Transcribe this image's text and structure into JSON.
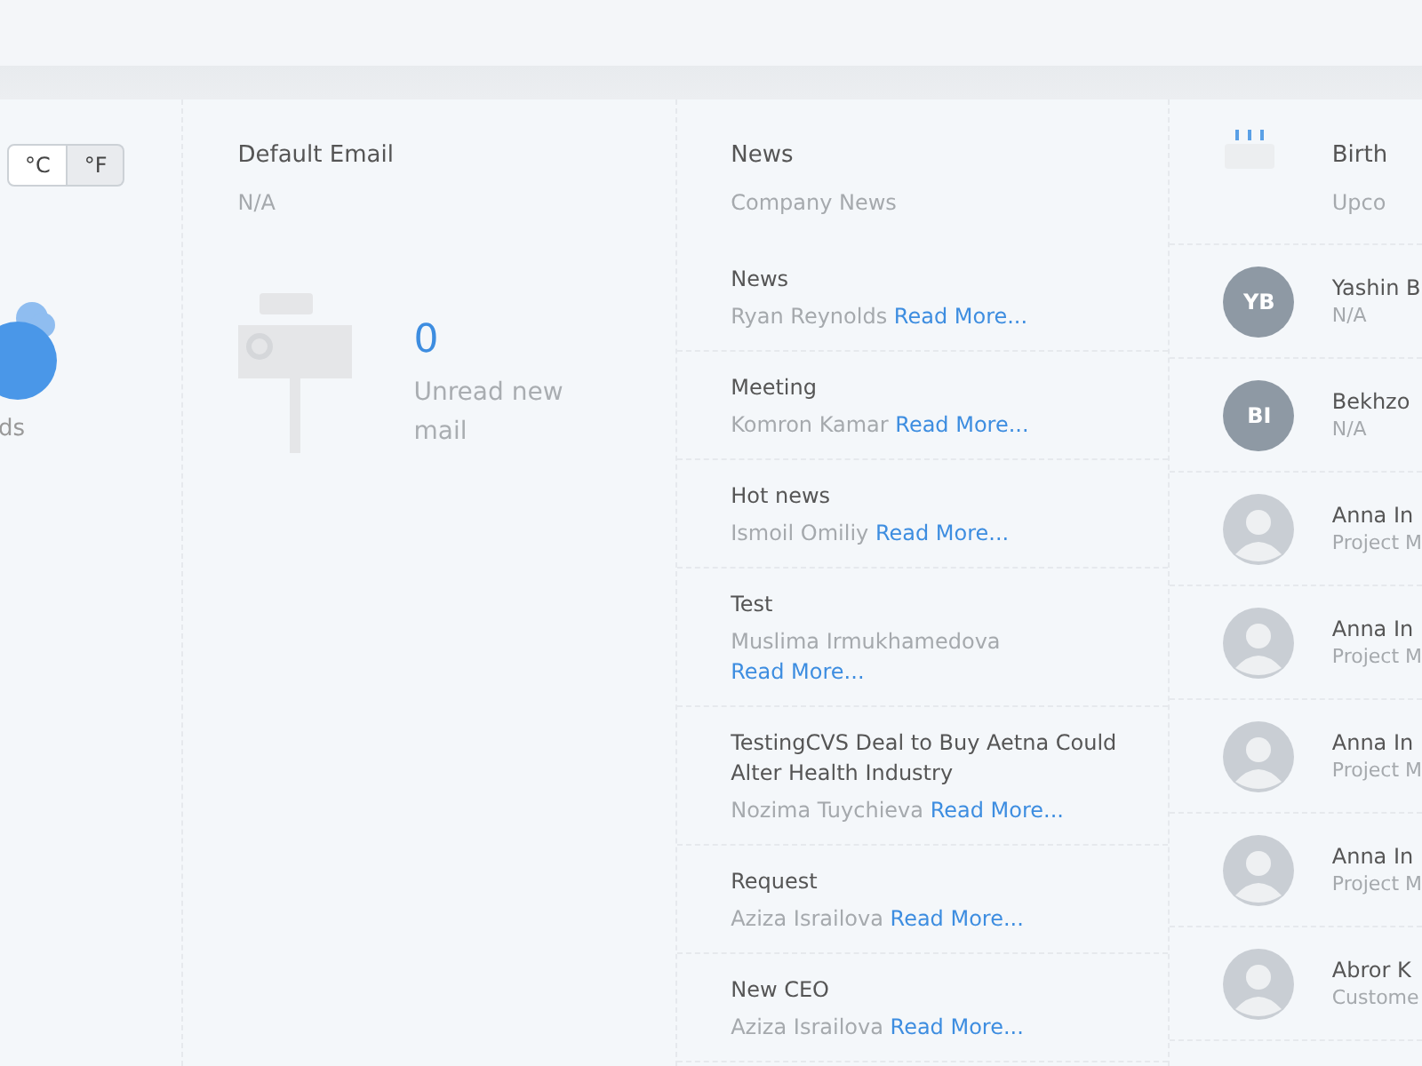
{
  "weather": {
    "units": [
      {
        "label": "°C",
        "selected": false
      },
      {
        "label": "°F",
        "selected": true
      }
    ],
    "caption": "ds"
  },
  "email": {
    "title": "Default Email",
    "value": "N/A",
    "count": "0",
    "label": "Unread new mail"
  },
  "news": {
    "title": "News",
    "subtitle": "Company News",
    "items": [
      {
        "title": "News",
        "author": "Ryan Reynolds",
        "link": "Read More..."
      },
      {
        "title": "Meeting",
        "author": "Komron Kamar",
        "link": "Read More..."
      },
      {
        "title": "Hot news",
        "author": "Ismoil Omiliy",
        "link": "Read More..."
      },
      {
        "title": "Test",
        "author": "Muslima Irmukhamedova",
        "link": "Read More..."
      },
      {
        "title": "TestingCVS Deal to Buy Aetna Could Alter Health Industry",
        "author": "Nozima Tuychieva",
        "link": "Read More..."
      },
      {
        "title": "Request",
        "author": "Aziza Israilova",
        "link": "Read More..."
      },
      {
        "title": "New CEO",
        "author": "Aziza Israilova",
        "link": "Read More..."
      }
    ]
  },
  "birthdays": {
    "title": "Birth",
    "subtitle": "Upco",
    "people": [
      {
        "name": "Yashin B",
        "role": "N/A",
        "avatar": {
          "kind": "initials",
          "text": "YB"
        }
      },
      {
        "name": "Bekhzo",
        "role": "N/A",
        "avatar": {
          "kind": "initials",
          "text": "BI"
        }
      },
      {
        "name": "Anna In",
        "role": "Project M",
        "avatar": {
          "kind": "photo"
        }
      },
      {
        "name": "Anna In",
        "role": "Project M",
        "avatar": {
          "kind": "photo"
        }
      },
      {
        "name": "Anna In",
        "role": "Project M",
        "avatar": {
          "kind": "photo"
        }
      },
      {
        "name": "Anna In",
        "role": "Project M",
        "avatar": {
          "kind": "photo"
        }
      },
      {
        "name": "Abror K",
        "role": "Custome",
        "avatar": {
          "kind": "photo"
        }
      }
    ]
  }
}
